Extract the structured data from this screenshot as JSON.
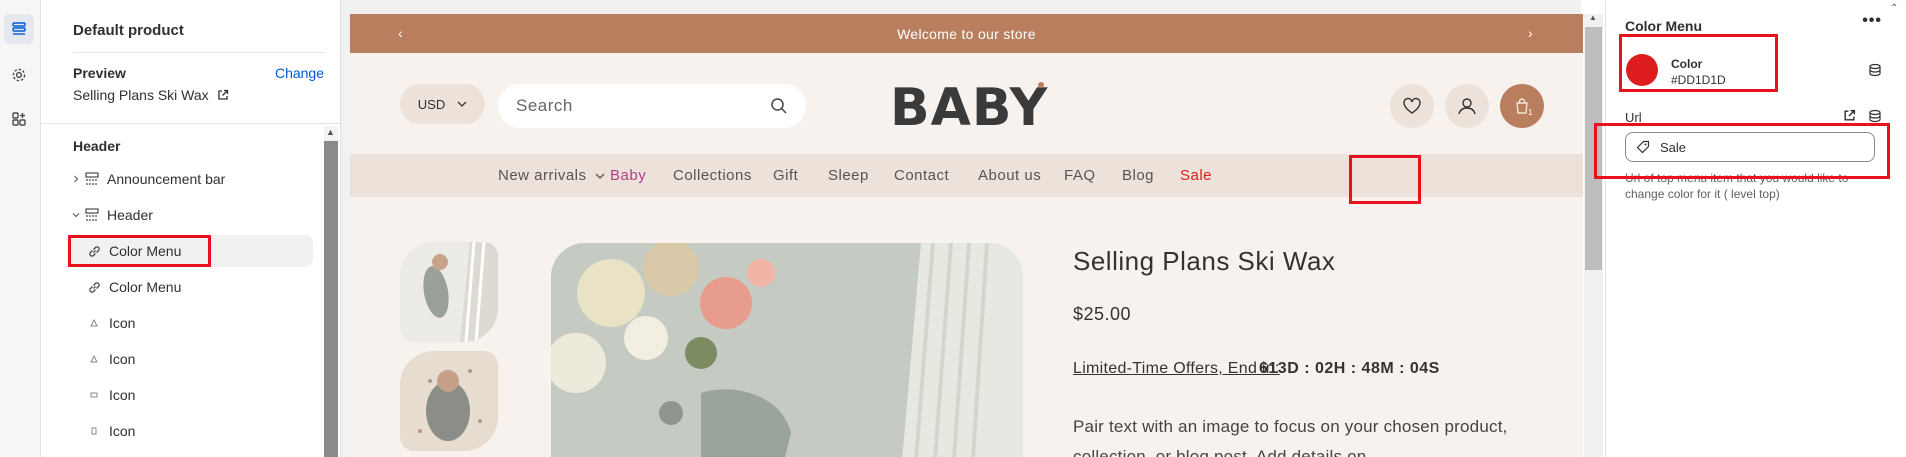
{
  "rail": {
    "items": [
      "sections-icon",
      "settings-icon",
      "apps-icon"
    ]
  },
  "sidebar": {
    "title": "Default product",
    "preview_label": "Preview",
    "change_label": "Change",
    "preview_value": "Selling Plans Ski Wax",
    "header_label": "Header",
    "rows": [
      {
        "label": "Announcement bar"
      },
      {
        "label": "Header"
      },
      {
        "label": "Color Menu"
      },
      {
        "label": "Color Menu"
      },
      {
        "label": "Icon"
      },
      {
        "label": "Icon"
      },
      {
        "label": "Icon"
      },
      {
        "label": "Icon"
      }
    ]
  },
  "store": {
    "announcement": "Welcome to our store",
    "currency": "USD",
    "search_placeholder": "Search",
    "logo": "BABY",
    "cart_count": "1",
    "nav": [
      "New arrivals",
      "Baby",
      "Collections",
      "Gift",
      "Sleep",
      "Contact",
      "About us",
      "FAQ",
      "Blog",
      "Sale"
    ],
    "product": {
      "title": "Selling Plans Ski Wax",
      "price": "$25.00",
      "offer_label": "Limited-Time Offers, End in:",
      "timer": "613D : 02H : 48M : 04S",
      "description": "Pair text with an image to focus on your chosen product, collection, or blog post. Add details on"
    }
  },
  "panel": {
    "title": "Color Menu",
    "more": "•••",
    "color_label": "Color",
    "color_value": "#DD1D1D",
    "url_label": "Url",
    "url_value": "Sale",
    "help": "Url of top menu item that you would like to change color for it ( level top)"
  },
  "colors": {
    "accent": "#b87e5e",
    "sale": "#dd1d1d",
    "highlight": "#e8121e",
    "link": "#005bd3"
  }
}
